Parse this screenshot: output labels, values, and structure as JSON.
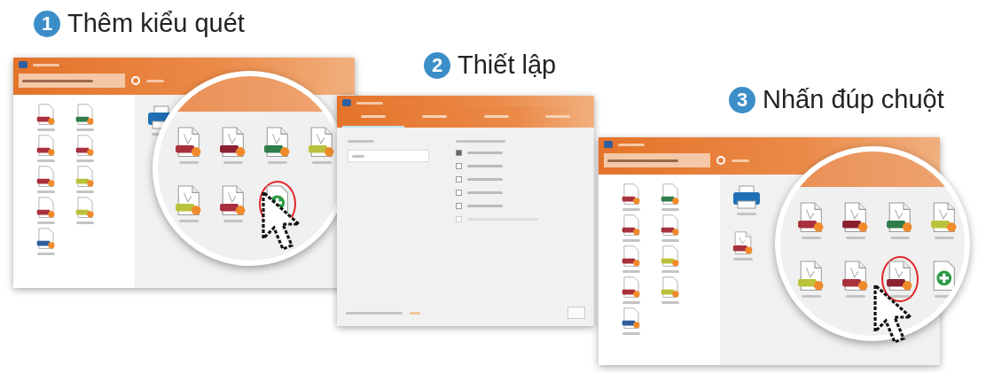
{
  "steps": [
    {
      "number": "1",
      "title": "Thêm kiểu quét"
    },
    {
      "number": "2",
      "title": "Thiết lập"
    },
    {
      "number": "3",
      "title": "Nhấn đúp chuột"
    }
  ],
  "window_1": {
    "sidebar_profiles": [
      {
        "color": "#a8313d"
      },
      {
        "color": "#2f7d4a"
      },
      {
        "color": "#a8313d"
      },
      {
        "color": "#a8313d"
      },
      {
        "color": "#a8313d"
      },
      {
        "color": "#b9c23a"
      },
      {
        "color": "#a8313d"
      },
      {
        "color": "#b9c23a"
      },
      {
        "color": "#2f5f9e"
      }
    ],
    "magnified_profiles": [
      {
        "kind": "file",
        "color": "#a8313d",
        "selected": false
      },
      {
        "kind": "file",
        "color": "#8a2030",
        "selected": false
      },
      {
        "kind": "file",
        "color": "#2f7d4a",
        "selected": false
      },
      {
        "kind": "file",
        "color": "#b9c23a",
        "selected": false
      },
      {
        "kind": "file",
        "color": "#b9c23a",
        "selected": false
      },
      {
        "kind": "file",
        "color": "#a8313d",
        "selected": false
      },
      {
        "kind": "new",
        "selected": true
      }
    ]
  },
  "window_2": {
    "tabs": [
      {
        "selected": true
      },
      {
        "selected": false
      },
      {
        "selected": false
      },
      {
        "selected": false
      }
    ],
    "options": [
      {
        "checked": true,
        "disabled": false
      },
      {
        "checked": false,
        "disabled": false
      },
      {
        "checked": false,
        "disabled": false
      },
      {
        "checked": false,
        "disabled": false
      },
      {
        "checked": false,
        "disabled": false
      },
      {
        "checked": false,
        "disabled": true
      }
    ]
  },
  "window_3": {
    "sidebar_profiles": [
      {
        "color": "#a8313d"
      },
      {
        "color": "#2f7d4a"
      },
      {
        "color": "#a8313d"
      },
      {
        "color": "#a8313d"
      },
      {
        "color": "#a8313d"
      },
      {
        "color": "#b9c23a"
      },
      {
        "color": "#a8313d"
      },
      {
        "color": "#b9c23a"
      },
      {
        "color": "#2f5f9e"
      }
    ],
    "magnified_profiles": [
      {
        "kind": "file",
        "color": "#a8313d",
        "selected": false
      },
      {
        "kind": "file",
        "color": "#8a2030",
        "selected": false
      },
      {
        "kind": "file",
        "color": "#2f7d4a",
        "selected": false
      },
      {
        "kind": "file",
        "color": "#b9c23a",
        "selected": false
      },
      {
        "kind": "file",
        "color": "#b9c23a",
        "selected": false
      },
      {
        "kind": "file",
        "color": "#a8313d",
        "selected": false
      },
      {
        "kind": "file",
        "color": "#8a2030",
        "selected": true
      },
      {
        "kind": "new",
        "selected": false
      }
    ]
  }
}
